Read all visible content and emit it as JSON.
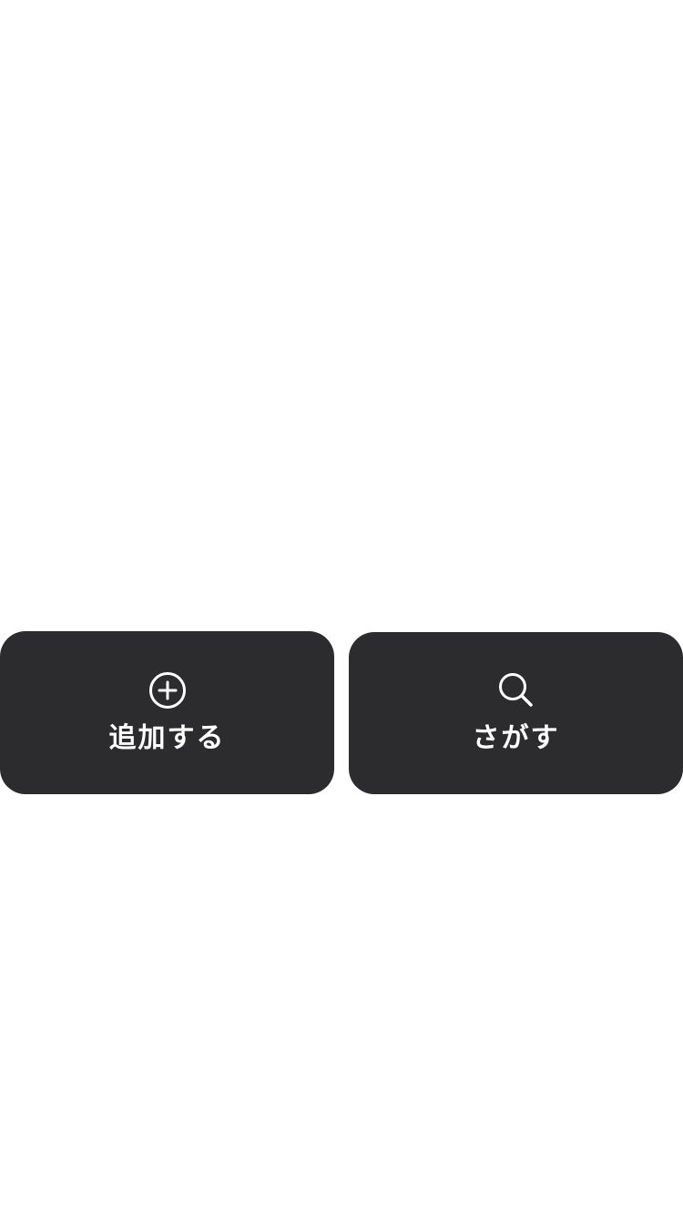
{
  "actions": {
    "add": {
      "label": "追加する",
      "icon": "plus-circle-icon"
    },
    "search": {
      "label": "さがす",
      "icon": "search-icon"
    }
  },
  "colors": {
    "background": "#ffffff",
    "card": "#2c2c2e",
    "text": "#ffffff"
  }
}
